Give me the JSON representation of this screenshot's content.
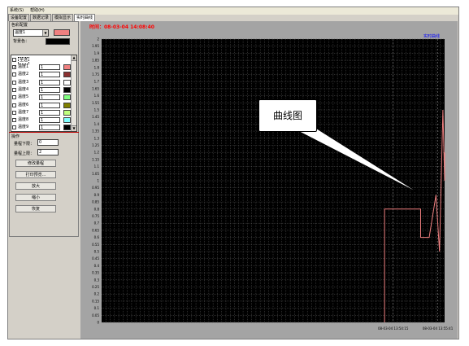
{
  "menu": [
    "系统(S)",
    "帮助(H)"
  ],
  "tabs": [
    "设备配置",
    "数据记录",
    "模拟显示",
    "实时曲线"
  ],
  "color_config": {
    "title": "色彩配置",
    "selected_channel": "温度1",
    "selected_color": "#f08080",
    "background_label": "背景色：",
    "background_color": "#000000"
  },
  "channel_list": {
    "all_label": "全选",
    "items": [
      {
        "name": "温度1",
        "value": "1",
        "checked": true,
        "color": "#f08080"
      },
      {
        "name": "温度2",
        "value": "1",
        "checked": false,
        "color": "#8b3030"
      },
      {
        "name": "温度3",
        "value": "1",
        "checked": false,
        "color": "#ffffff"
      },
      {
        "name": "温度4",
        "value": "1",
        "checked": false,
        "color": "#000000"
      },
      {
        "name": "温度5",
        "value": "1",
        "checked": false,
        "color": "#80ff80"
      },
      {
        "name": "温度6",
        "value": "1",
        "checked": false,
        "color": "#808000"
      },
      {
        "name": "温度7",
        "value": "1",
        "checked": false,
        "color": "#c0ff80"
      },
      {
        "name": "温度8",
        "value": "1",
        "checked": false,
        "color": "#80ffff"
      },
      {
        "name": "温度9",
        "value": "1",
        "checked": false,
        "color": "#000000"
      }
    ]
  },
  "operations": {
    "title": "操作",
    "range_min_label": "量程下限：",
    "range_min_value": "0",
    "range_max_label": "量程上限：",
    "range_max_value": "2",
    "buttons": [
      "修改量程",
      "打印预览...",
      "放大",
      "缩小",
      "恢复"
    ]
  },
  "chart_data": {
    "type": "line",
    "title": "时间：08-03-04 14:08:40",
    "legend": [
      "实时曲线"
    ],
    "legend_position": "top-right",
    "ylim": [
      0,
      2
    ],
    "yticks": [
      "0",
      "0.05",
      "0.1",
      "0.15",
      "0.2",
      "0.25",
      "0.3",
      "0.35",
      "0.4",
      "0.45",
      "0.5",
      "0.55",
      "0.6",
      "0.65",
      "0.7",
      "0.75",
      "0.8",
      "0.85",
      "0.9",
      "0.95",
      "1",
      "1.05",
      "1.1",
      "1.15",
      "1.2",
      "1.25",
      "1.3",
      "1.35",
      "1.4",
      "1.45",
      "1.5",
      "1.55",
      "1.6",
      "1.65",
      "1.7",
      "1.75",
      "1.8",
      "1.85",
      "1.9",
      "1.95",
      "2"
    ],
    "xticks": [
      "08-03-04 13:54:15",
      "08-03-04 13:55:41"
    ],
    "grid": true,
    "background": "#000000",
    "series_color": "#f08080",
    "series": [
      {
        "values": [
          0,
          0.8,
          0.8,
          0.8,
          0.6,
          0.6,
          0.9,
          0.5,
          1.5,
          1.0,
          1.2,
          1.0
        ]
      }
    ]
  },
  "annotation": {
    "label": "曲线图"
  }
}
